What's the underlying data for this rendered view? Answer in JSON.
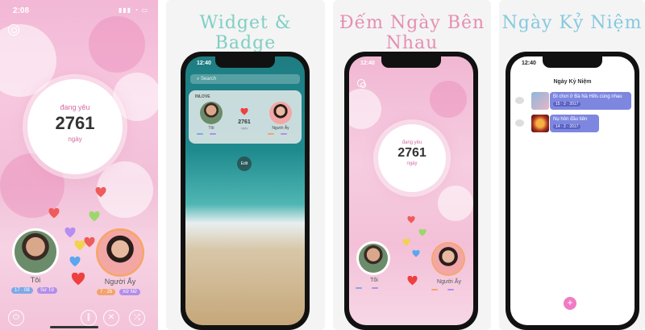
{
  "panel1": {
    "status_time": "2:08",
    "counter_label": "đang yêu",
    "counter_value": "2761",
    "counter_unit": "ngày",
    "person_left": {
      "name": "Tôi",
      "badge_left": "17 · 08",
      "badge_right": "Sư Tử"
    },
    "person_right": {
      "name": "Người Ấy",
      "badge_left": "7 · 26",
      "badge_right": "Xử Nữ"
    },
    "controls": [
      "power-icon",
      "pause-icon",
      "mute-icon",
      "shuffle-icon"
    ]
  },
  "panel2": {
    "title": "Widget & Badge",
    "phone_time": "12:40",
    "search_placeholder": "Search",
    "widget_header": "INLOVE",
    "widget_counter_value": "2761",
    "widget_counter_unit": "ngày",
    "person_left": {
      "name": "Tôi"
    },
    "person_right": {
      "name": "Người Ấy"
    },
    "edit_label": "Edit"
  },
  "panel3": {
    "title": "Đếm Ngày Bên Nhau",
    "phone_time": "12:40",
    "counter_label": "đang yêu",
    "counter_value": "2761",
    "counter_unit": "ngày",
    "person_left": {
      "name": "Tôi"
    },
    "person_right": {
      "name": "Người Ấy"
    }
  },
  "panel4": {
    "title": "Ngày Kỷ Niệm",
    "phone_time": "12:40",
    "list_title": "Ngày Kỷ Niệm",
    "memories": [
      {
        "text": "Đi chơi ở Bà Nà Hills cùng nhau",
        "date": "15 · 2 · 2017"
      },
      {
        "text": "Nụ hôn đầu tiên",
        "date": "14 · 2 · 2017"
      }
    ],
    "add_label": "+"
  },
  "colors": {
    "pink_accent": "#d36aa3",
    "teal_title": "#7fcfc3",
    "pink_title": "#e58fb1",
    "blue_title": "#86c9df",
    "memory_card": "#7d87e0"
  }
}
